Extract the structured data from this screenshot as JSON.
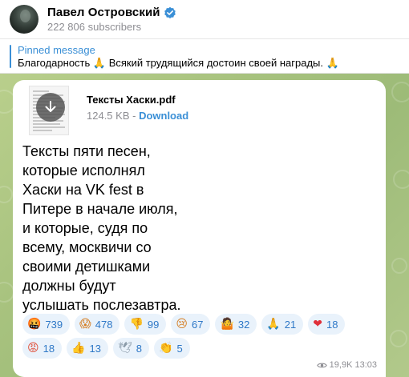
{
  "channel": {
    "name": "Павел Островский",
    "subscribers": "222 806 subscribers",
    "verified_icon": "verified-badge-icon"
  },
  "pinned": {
    "title": "Pinned message",
    "text": "Благодарность 🙏 Всякий трудящийся достоин своей награды. 🙏"
  },
  "file": {
    "name": "Тексты Хаски.pdf",
    "size": "124.5 KB",
    "separator": " - ",
    "download_label": "Download",
    "icon": "download-arrow-icon"
  },
  "message": {
    "lines": [
      "Тексты пяти песен,",
      "которые исполнял",
      "Хаски на VK fest в",
      "Питере в начале июля,",
      "и которые, судя по",
      "всему, москвичи со",
      "своими детишками",
      "должны будут",
      "услышать послезавтра."
    ]
  },
  "reactions": {
    "row1": [
      {
        "emoji": "🤬",
        "count": "739"
      },
      {
        "emoji": "😱",
        "count": "478"
      },
      {
        "emoji": "👎",
        "count": "99"
      },
      {
        "emoji": "😢",
        "count": "67"
      },
      {
        "emoji": "🤷",
        "count": "32"
      },
      {
        "emoji": "🙏",
        "count": "21"
      },
      {
        "emoji": "❤",
        "count": "18"
      }
    ],
    "row2": [
      {
        "emoji": "😡",
        "count": "18"
      },
      {
        "emoji": "👍",
        "count": "13"
      },
      {
        "emoji": "🕊",
        "count": "8"
      },
      {
        "emoji": "👏",
        "count": "5"
      }
    ]
  },
  "footer": {
    "views": "19,9K",
    "time": "13:03"
  },
  "colors": {
    "accent": "#3a8fd6",
    "chat_background": "#a7c27e",
    "reaction_bg": "#e9f2fb"
  }
}
